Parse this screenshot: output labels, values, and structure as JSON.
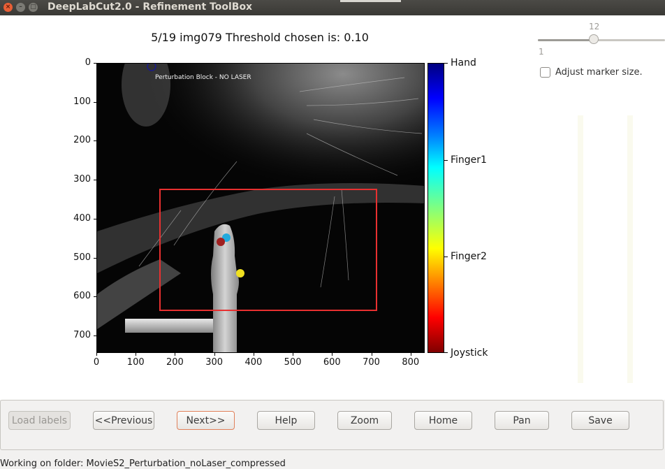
{
  "window": {
    "title": "DeepLabCut2.0 - Refinement ToolBox",
    "close_glyph": "×",
    "min_glyph": "–",
    "max_glyph": "□"
  },
  "plot": {
    "title": "5/19 img079  Threshold chosen is: 0.10",
    "overlay_text": "Perturbation Block - NO LASER",
    "x_ticks": [
      "0",
      "100",
      "200",
      "300",
      "400",
      "500",
      "600",
      "700",
      "800"
    ],
    "y_ticks": [
      "0",
      "100",
      "200",
      "300",
      "400",
      "500",
      "600",
      "700"
    ]
  },
  "colorbar": {
    "labels": [
      "Hand",
      "Finger1",
      "Finger2",
      "Joystick"
    ]
  },
  "markers": [
    {
      "label": "Hand",
      "x": 140,
      "y": 8,
      "color": "#1a1a8c",
      "style": "hollow"
    },
    {
      "label": "Finger1",
      "x": 330,
      "y": 445,
      "color": "#22aadd",
      "style": "filled"
    },
    {
      "label": "Joystick",
      "x": 316,
      "y": 458,
      "color": "#a02020",
      "style": "filled"
    },
    {
      "label": "Finger2",
      "x": 368,
      "y": 538,
      "color": "#f0e020",
      "style": "filled"
    }
  ],
  "roi": {
    "x1": 160,
    "y1": 323,
    "x2": 718,
    "y2": 635,
    "color": "#e83030"
  },
  "slider": {
    "value": "12",
    "min_label": "1",
    "fraction": 0.44
  },
  "checkbox": {
    "label": "Adjust marker size.",
    "checked": false
  },
  "buttons": {
    "load": "Load labels",
    "previous": "<<Previous",
    "next": "Next>>",
    "help": "Help",
    "zoom": "Zoom",
    "home": "Home",
    "pan": "Pan",
    "save": "Save"
  },
  "status": {
    "text": "Working on folder: MovieS2_Perturbation_noLaser_compressed"
  }
}
